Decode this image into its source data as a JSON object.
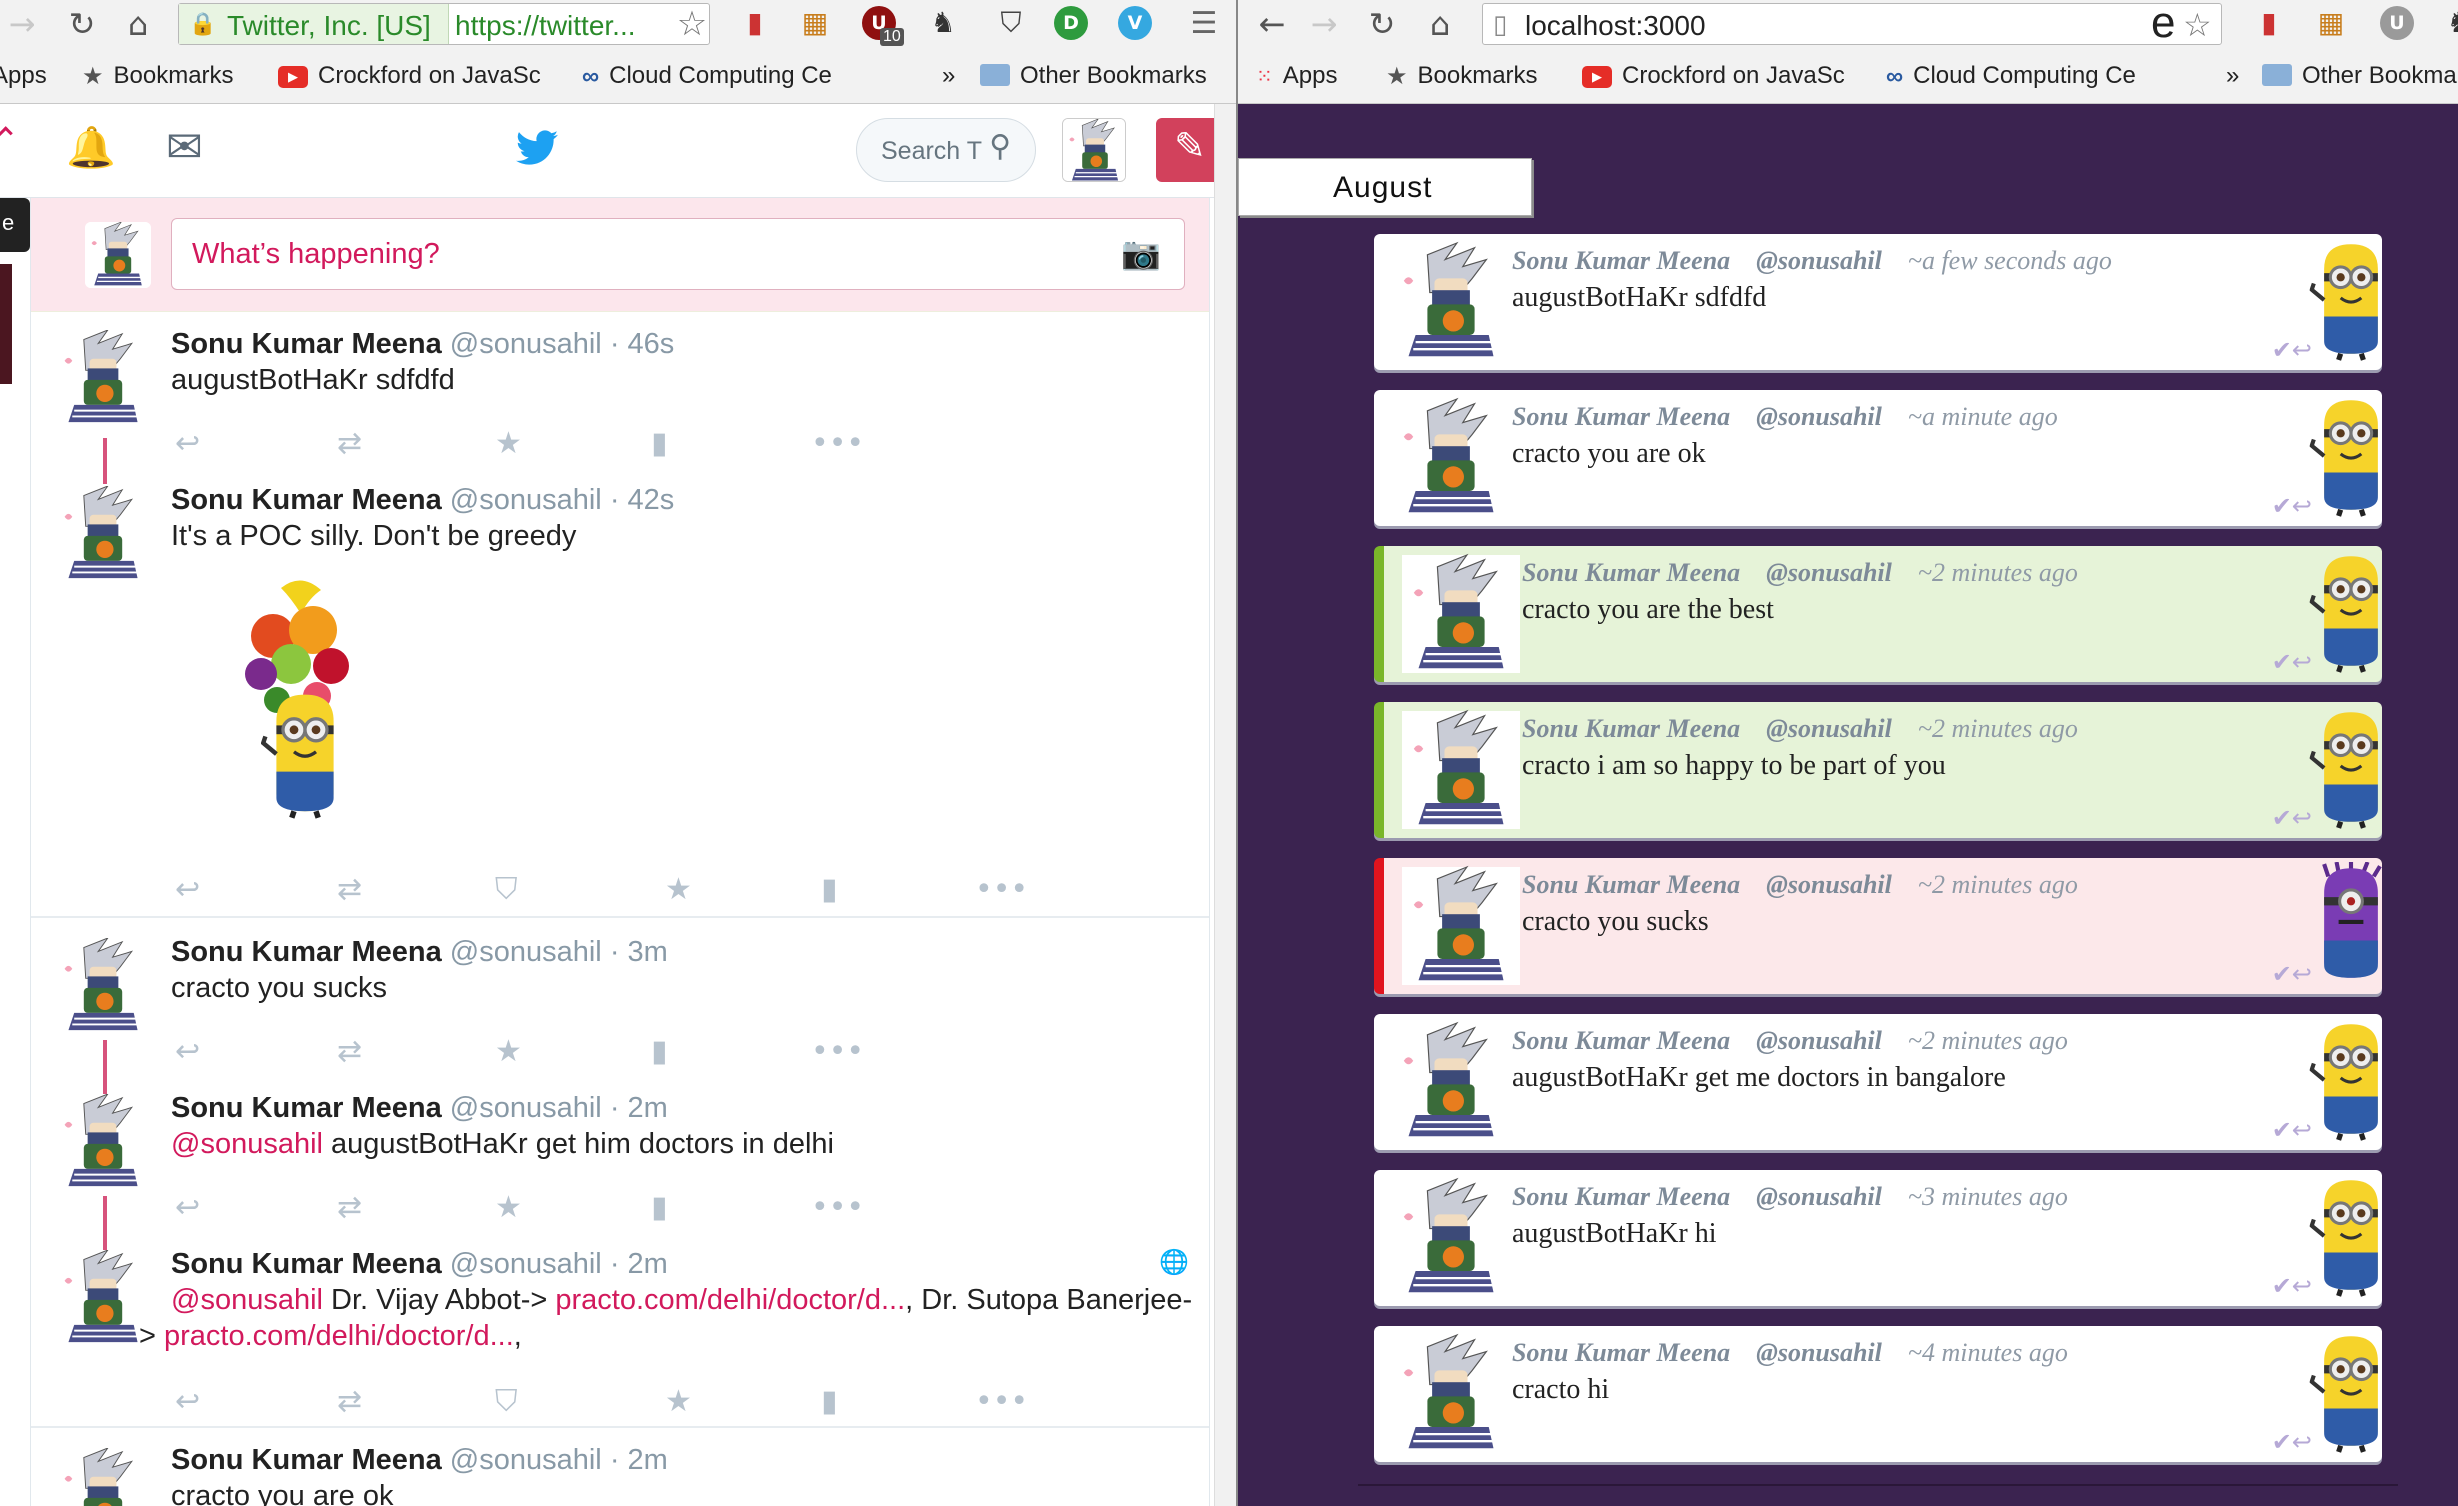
{
  "left_browser": {
    "site_identity": "Twitter, Inc. [US]",
    "url": "https://twitter...",
    "extension_badge": "10",
    "bookmarks": {
      "apps": "Apps",
      "bookmarks": "Bookmarks",
      "crockford": "Crockford on JavaSc",
      "cloud": "Cloud Computing Ce",
      "overflow": "»",
      "other": "Other Bookmarks"
    }
  },
  "twitter": {
    "search_placeholder": "Search T",
    "compose_placeholder": "What’s happening?",
    "side_tab_text": "e",
    "tweets": [
      {
        "name": "Sonu Kumar Meena",
        "handle": "@sonusahil",
        "time": "· 46s",
        "text": "augustBotHaKr sdfdfd"
      },
      {
        "name": "Sonu Kumar Meena",
        "handle": "@sonusahil",
        "time": "· 42s",
        "text": "It's a POC silly. Don't be greedy"
      },
      {
        "name": "Sonu Kumar Meena",
        "handle": "@sonusahil",
        "time": "· 3m",
        "text": "cracto you sucks"
      },
      {
        "name": "Sonu Kumar Meena",
        "handle": "@sonusahil",
        "time": "· 2m",
        "mention": "@sonusahil",
        "text": " augustBotHaKr get him doctors in delhi"
      },
      {
        "name": "Sonu Kumar Meena",
        "handle": "@sonusahil",
        "time": "· 2m",
        "mention": "@sonusahil",
        "text_a": " Dr. Vijay Abbot-> ",
        "link_a": "practo.com/delhi/doctor/d...",
        "text_b": ", Dr. Sutopa Banerjee-",
        "text_c": "> ",
        "link_b": "practo.com/delhi/doctor/d...",
        "text_d": ","
      },
      {
        "name": "Sonu Kumar Meena",
        "handle": "@sonusahil",
        "time": "· 2m",
        "text": "cracto you are ok"
      }
    ]
  },
  "right_browser": {
    "url": "localhost:3000",
    "bookmarks": {
      "apps": "Apps",
      "bookmarks": "Bookmarks",
      "crockford": "Crockford on JavaSc",
      "cloud": "Cloud Computing Ce",
      "overflow": "»",
      "other": "Other Bookma"
    }
  },
  "august": {
    "tab_label": "August",
    "cards": [
      {
        "name": "Sonu Kumar Meena",
        "handle": "@sonusahil",
        "time": "~a few seconds ago",
        "text": "augustBotHaKr sdfdfd",
        "sentiment": "neutral"
      },
      {
        "name": "Sonu Kumar Meena",
        "handle": "@sonusahil",
        "time": "~a minute ago",
        "text": "cracto you are ok",
        "sentiment": "neutral"
      },
      {
        "name": "Sonu Kumar Meena",
        "handle": "@sonusahil",
        "time": "~2 minutes ago",
        "text": "cracto you are the best",
        "sentiment": "positive"
      },
      {
        "name": "Sonu Kumar Meena",
        "handle": "@sonusahil",
        "time": "~2 minutes ago",
        "text": "cracto i am so happy to be part of you",
        "sentiment": "positive"
      },
      {
        "name": "Sonu Kumar Meena",
        "handle": "@sonusahil",
        "time": "~2 minutes ago",
        "text": "cracto you sucks",
        "sentiment": "negative"
      },
      {
        "name": "Sonu Kumar Meena",
        "handle": "@sonusahil",
        "time": "~2 minutes ago",
        "text": "augustBotHaKr get me doctors in bangalore",
        "sentiment": "neutral"
      },
      {
        "name": "Sonu Kumar Meena",
        "handle": "@sonusahil",
        "time": "~3 minutes ago",
        "text": "augustBotHaKr hi",
        "sentiment": "neutral"
      },
      {
        "name": "Sonu Kumar Meena",
        "handle": "@sonusahil",
        "time": "~4 minutes ago",
        "text": "cracto hi",
        "sentiment": "neutral"
      }
    ]
  },
  "colors": {
    "twitter_pink": "#d2195c",
    "august_bg": "#3b2350",
    "positive": "#7ab62a",
    "negative": "#e0141e",
    "twitter_blue": "#1da1f2"
  }
}
